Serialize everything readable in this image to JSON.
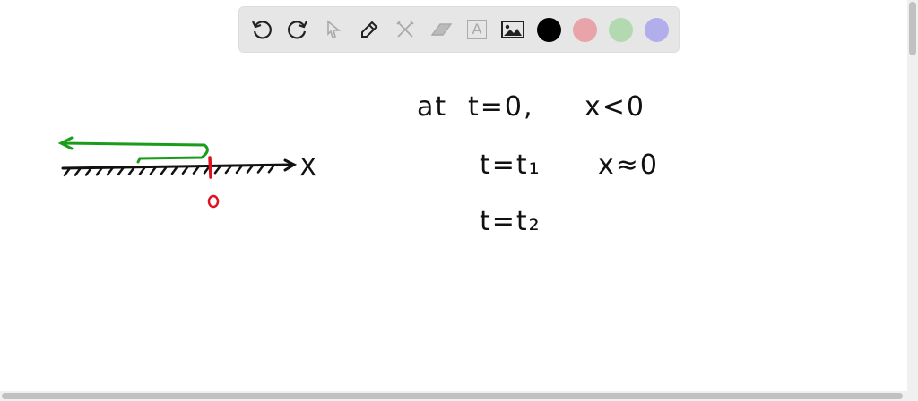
{
  "toolbar": {
    "tools": [
      "undo-icon",
      "redo-icon",
      "pointer-icon",
      "pen-icon",
      "tools-icon",
      "eraser-icon",
      "text-icon",
      "image-icon"
    ],
    "text_tool_glyph": "A",
    "colors": {
      "black": "#000000",
      "red": "#e8a4a8",
      "green": "#b3d9b0",
      "blue": "#b2aeeb"
    }
  },
  "canvas": {
    "axis_label": "X",
    "origin_label": "0",
    "lines": [
      {
        "left": "at",
        "eq": "t=0,",
        "right": "x<0"
      },
      {
        "eq": "t=t₁",
        "right": "x≈0"
      },
      {
        "eq": "t=t₂"
      }
    ],
    "ink": {
      "axis": "#111111",
      "path": "#1a9c1a",
      "origin": "#e01020"
    }
  }
}
